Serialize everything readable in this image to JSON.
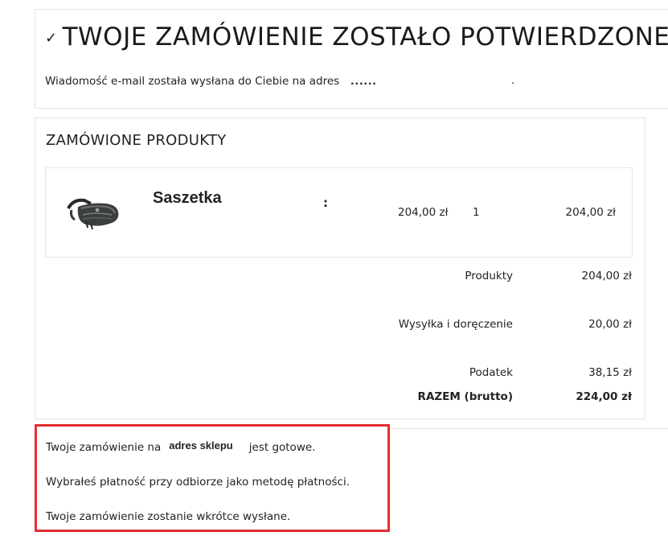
{
  "confirmation": {
    "check_icon": "✓",
    "title": "TWOJE ZAMÓWIENIE ZOSTAŁO POTWIERDZONE",
    "email_text": "Wiadomość e-mail została wysłana do Ciebie na adres",
    "email_redacted": "......",
    "period": "."
  },
  "products": {
    "section_title": "ZAMÓWIONE PRODUKTY",
    "items": [
      {
        "image_icon": "belt-bag-image",
        "name": "Saszetka",
        "colon": ":",
        "unit_price": "204,00 zł",
        "quantity": "1",
        "total": "204,00 zł"
      }
    ]
  },
  "summary": {
    "products_label": "Produkty",
    "products_value": "204,00 zł",
    "shipping_label": "Wysyłka i doręczenie",
    "shipping_value": "20,00 zł",
    "tax_label": "Podatek",
    "tax_value": "38,15 zł",
    "total_label": "RAZEM (brutto)",
    "total_value": "224,00 zł"
  },
  "info": {
    "line1_prefix": "Twoje zamówienie na",
    "shop_address": "adres sklepu",
    "line1_suffix": "jest gotowe.",
    "line2": "Wybrałeś płatność przy odbiorze jako metodę płatności.",
    "line3": "Twoje zamówienie zostanie wkrótce wysłane."
  },
  "colors": {
    "highlight_border": "#e52d32",
    "card_border": "#e5e5e5",
    "text": "#232323"
  }
}
